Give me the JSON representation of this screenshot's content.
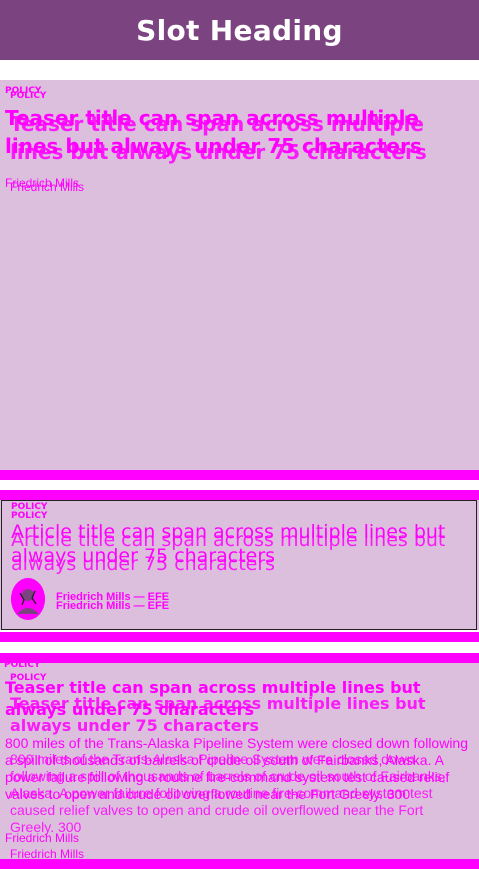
{
  "header": {
    "title": "Slot Heading"
  },
  "teaser_top": {
    "kicker": "POLICY",
    "title": "Teaser title can span across multiple lines but always under 75 characters",
    "author": "Friedrich Mills"
  },
  "article": {
    "kicker": "POLICY",
    "title": "Article title can span across multiple lines but always under 75 characters",
    "byline": "Friedrich Mills — EFE",
    "avatar_icon": "author-avatar"
  },
  "teaser_bottom": {
    "kicker": "POLICY",
    "title": "Teaser title can span across multiple lines but always under 75 characters",
    "summary": "800 miles of the Trans-Alaska Pipeline System were closed down following a spill of thousands of barrels of crude oil south of Fairbanks, Alaska. A power failure following a routine fire-command system test caused relief valves to open and crude oil overflowed near the Fort Greely. 300",
    "author": "Friedrich Mills"
  },
  "colors": {
    "header": "#7b437f",
    "panel": "#dbbfdc",
    "accent": "#ff00ff"
  }
}
